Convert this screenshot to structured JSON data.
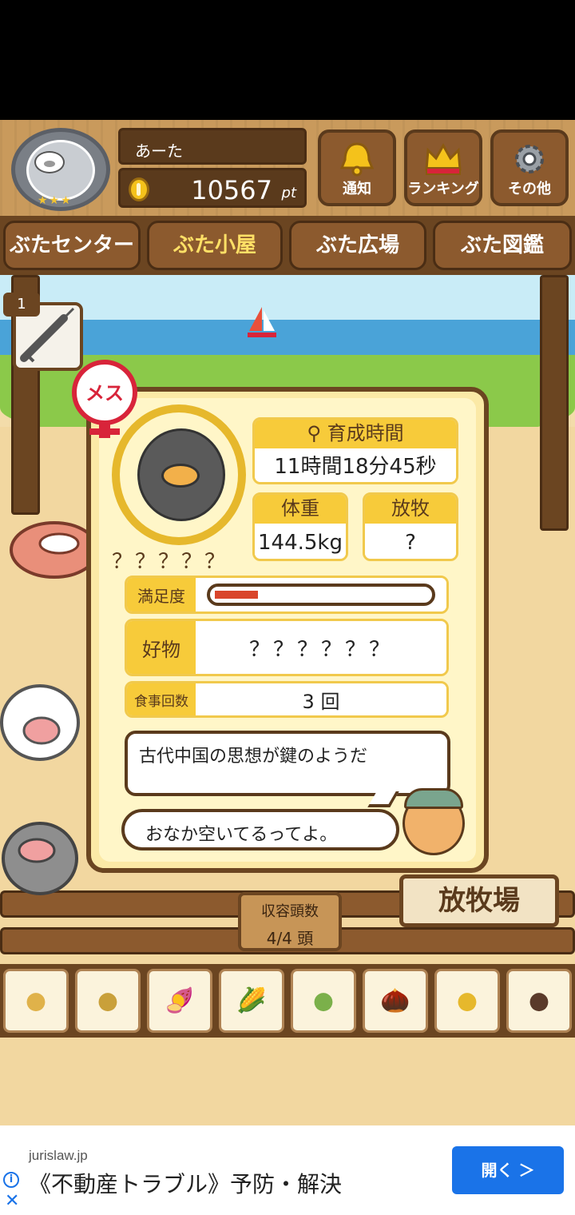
{
  "header": {
    "user_name": "あーた",
    "points": "10567",
    "points_unit": "pt",
    "buttons": {
      "notice": "通知",
      "ranking": "ランキング",
      "other": "その他"
    }
  },
  "nav": {
    "tabs": [
      {
        "label": "ぶたセンター"
      },
      {
        "label": "ぶた小屋",
        "active": true
      },
      {
        "label": "ぶた広場"
      },
      {
        "label": "ぶた図鑑"
      }
    ]
  },
  "item_slot": {
    "count": "1"
  },
  "pig": {
    "gender_badge": "メス",
    "name": "？？？？？",
    "growth_label": "育成時間",
    "growth_value": "11時間18分45秒",
    "weight_label": "体重",
    "weight_value": "144.5kg",
    "graze_label": "放牧",
    "graze_value": "?",
    "satisfaction_label": "満足度",
    "satisfaction_level": 0.2,
    "favorite_label": "好物",
    "favorite_value": "？？？？？？",
    "meals_label": "食事回数",
    "meals_value": "3 回",
    "pig_message": "古代中国の思想が鍵のようだ",
    "farmer_message": "おなか空いてるってよ。"
  },
  "capacity": {
    "label": "収容頭数",
    "value": "4/4 頭"
  },
  "pasture_sign": "放牧場",
  "foods": [
    {
      "icon": "grain-pile-icon",
      "glyph": "●"
    },
    {
      "icon": "mixed-grain-icon",
      "glyph": "●"
    },
    {
      "icon": "sweet-potato-icon",
      "glyph": "🍠"
    },
    {
      "icon": "corn-icon",
      "glyph": "🌽"
    },
    {
      "icon": "beans-icon",
      "glyph": "●"
    },
    {
      "icon": "acorn-icon",
      "glyph": "🌰"
    },
    {
      "icon": "corn-dish-icon",
      "glyph": "●"
    },
    {
      "icon": "meatball-dish-icon",
      "glyph": "●"
    }
  ],
  "ad": {
    "domain": "jurislaw.jp",
    "text": "《不動産トラブル》予防・解決",
    "button": "開く ＞"
  },
  "colors": {
    "accent": "#f7cb3a",
    "wood": "#6b4521",
    "female": "#d8243a",
    "ad_button": "#1a73e8"
  }
}
